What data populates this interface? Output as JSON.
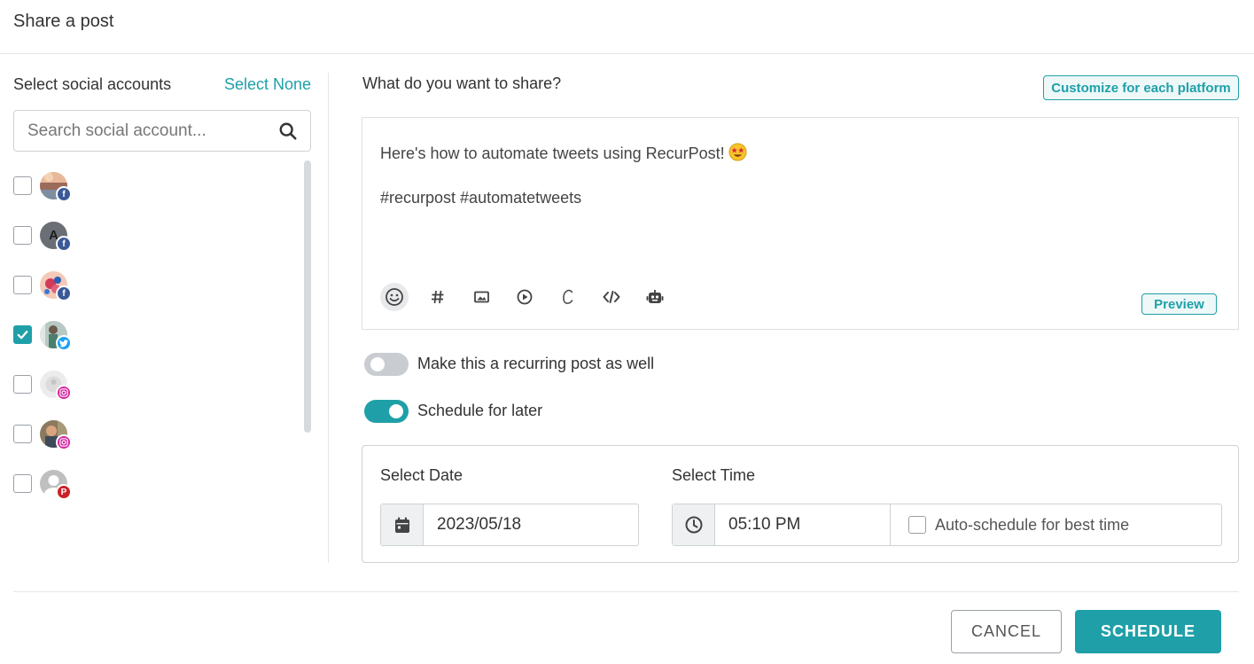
{
  "modal": {
    "title": "Share a post"
  },
  "accounts_panel": {
    "label": "Select social accounts",
    "select_none": "Select None",
    "search_placeholder": "Search social account...",
    "accounts": [
      {
        "platform": "facebook",
        "checked": false
      },
      {
        "platform": "facebook",
        "checked": false,
        "avatar_letter": "A"
      },
      {
        "platform": "facebook",
        "checked": false
      },
      {
        "platform": "twitter",
        "checked": true
      },
      {
        "platform": "instagram",
        "checked": false
      },
      {
        "platform": "instagram",
        "checked": false
      },
      {
        "platform": "pinterest",
        "checked": false
      }
    ]
  },
  "composer": {
    "question": "What do you want to share?",
    "customize_button": "Customize for each platform",
    "text_line1": "Here's how to automate tweets using RecurPost!",
    "text_line2": "#recurpost #automatetweets",
    "preview_button": "Preview",
    "toolbar_icons": [
      "emoji-icon",
      "hashtag-icon",
      "image-icon",
      "video-icon",
      "canva-icon",
      "code-icon",
      "bot-icon"
    ]
  },
  "options": {
    "recurring_label": "Make this a recurring post as well",
    "recurring_on": false,
    "schedule_later_label": "Schedule for later",
    "schedule_later_on": true
  },
  "schedule": {
    "date_label": "Select Date",
    "date_value": "2023/05/18",
    "time_label": "Select Time",
    "time_value": "05:10 PM",
    "auto_schedule_label": "Auto-schedule for best time",
    "auto_schedule_checked": false
  },
  "footer": {
    "cancel": "CANCEL",
    "schedule": "SCHEDULE"
  },
  "colors": {
    "accent": "#1fa0a8",
    "facebook": "#3b5998",
    "twitter": "#1da1f2",
    "instagram": "#d6249f",
    "pinterest": "#cb2027"
  }
}
